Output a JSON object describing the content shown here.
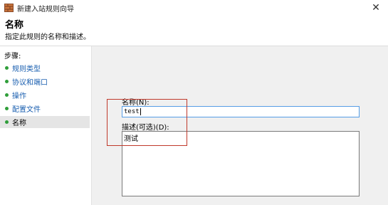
{
  "window": {
    "title": "新建入站规则向导"
  },
  "header": {
    "title": "名称",
    "subtitle": "指定此规则的名称和描述。"
  },
  "sidebar": {
    "steps_label": "步骤:",
    "items": [
      {
        "label": "规则类型",
        "state": "done"
      },
      {
        "label": "协议和端口",
        "state": "done"
      },
      {
        "label": "操作",
        "state": "done"
      },
      {
        "label": "配置文件",
        "state": "done"
      },
      {
        "label": "名称",
        "state": "current"
      }
    ]
  },
  "form": {
    "name_label": "名称(N):",
    "name_value": "test",
    "description_label": "描述(可选)(D):",
    "description_value": "测试"
  },
  "colors": {
    "bullet": "#2f9e3a",
    "link": "#1a5fb0",
    "focus_border": "#569de5",
    "highlight_box": "#c0392b"
  },
  "icons": {
    "app": "firewall-wizard-icon",
    "close": "close-icon"
  }
}
